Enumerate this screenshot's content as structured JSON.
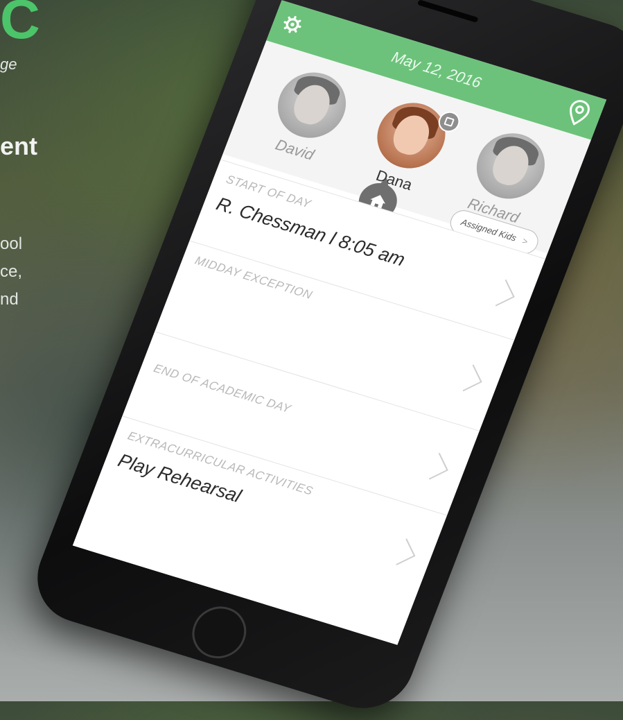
{
  "marketing": {
    "brand_fragment": "C",
    "tagline_fragment": "ge",
    "headline_fragment": "ent",
    "body_lines": [
      "ool",
      "ce,",
      "nd"
    ]
  },
  "app": {
    "date": "May 12, 2016",
    "accent_color": "#6cc27a",
    "icons": {
      "settings": "gear-icon",
      "location": "map-pin-icon",
      "home": "home-icon",
      "camera": "camera-icon",
      "chevron": "chevron-right-icon"
    },
    "kids": [
      {
        "name": "David",
        "selected": false
      },
      {
        "name": "Dana",
        "selected": true
      },
      {
        "name": "Richard",
        "selected": false
      }
    ],
    "assigned_button": "Assigned Kids",
    "assigned_chevron": ">",
    "rows": [
      {
        "label": "START OF DAY",
        "value": "R. Chessman l 8:05 am"
      },
      {
        "label": "MIDDAY EXCEPTION",
        "value": ""
      },
      {
        "label": "END OF ACADEMIC DAY",
        "value": ""
      },
      {
        "label": "EXTRACURRICULAR ACTIVITIES",
        "value": "Play Rehearsal"
      }
    ]
  }
}
